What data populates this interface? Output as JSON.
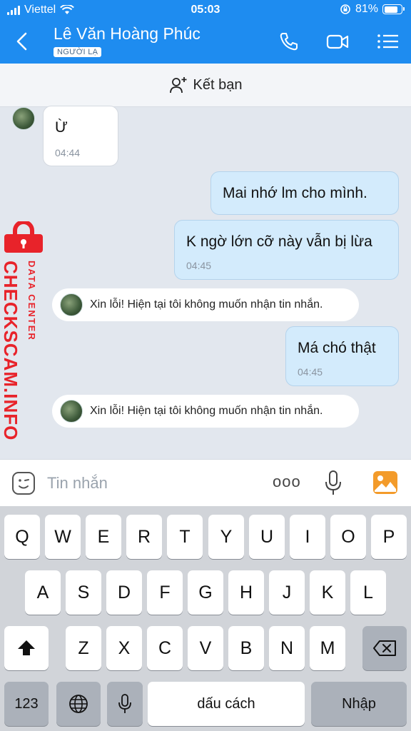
{
  "status_bar": {
    "carrier": "Viettel",
    "time": "05:03",
    "battery": "81%"
  },
  "header": {
    "contact_name": "Lê Văn Hoàng Phúc",
    "stranger_badge": "NGƯỜI LẠ"
  },
  "add_friend": {
    "label": "Kết bạn"
  },
  "messages": [
    {
      "direction": "in",
      "text": "Ừ",
      "time": "04:44"
    },
    {
      "direction": "out",
      "text": "Mai nhớ lm cho mình.",
      "time": ""
    },
    {
      "direction": "out",
      "text": "K ngờ lớn cỡ này vẫn bị lừa",
      "time": "04:45"
    },
    {
      "direction": "system",
      "text": "Xin lỗi! Hiện tại tôi không muốn nhận tin nhắn."
    },
    {
      "direction": "out",
      "text": "Má chó thật",
      "time": "04:45"
    },
    {
      "direction": "system",
      "text": "Xin lỗi! Hiện tại tôi không muốn nhận tin nhắn."
    }
  ],
  "watermark": {
    "brand": "CHECKSCAM.INFO",
    "sub": "DATA CENTER"
  },
  "composer": {
    "placeholder": "Tin nhắn",
    "more": "ooo"
  },
  "keyboard": {
    "row1": [
      "Q",
      "W",
      "E",
      "R",
      "T",
      "Y",
      "U",
      "I",
      "O",
      "P"
    ],
    "row2": [
      "A",
      "S",
      "D",
      "F",
      "G",
      "H",
      "J",
      "K",
      "L"
    ],
    "row3": [
      "Z",
      "X",
      "C",
      "V",
      "B",
      "N",
      "M"
    ],
    "numbers_key": "123",
    "space_key": "dấu cách",
    "return_key": "Nhập"
  },
  "colors": {
    "header": "#1e8cf0",
    "outgoing_bubble": "#d3ebfc",
    "watermark": "#e8232a"
  }
}
